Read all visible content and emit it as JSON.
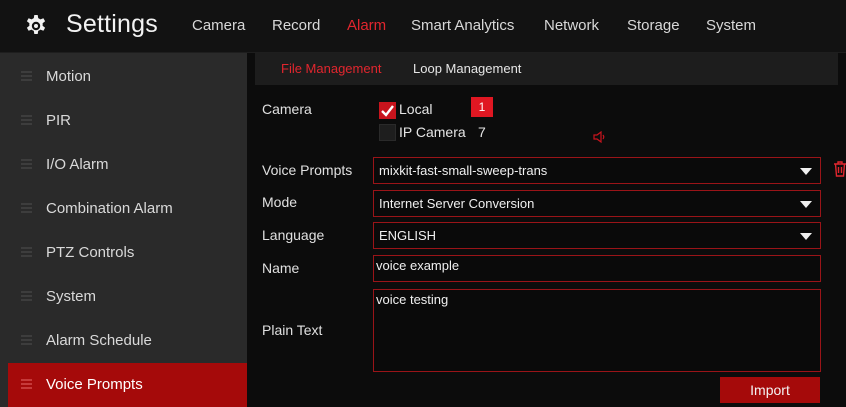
{
  "header": {
    "title": "Settings",
    "icon": "gear-icon",
    "tabs": [
      {
        "label": "Camera",
        "active": false
      },
      {
        "label": "Record",
        "active": false
      },
      {
        "label": "Alarm",
        "active": true
      },
      {
        "label": "Smart Analytics",
        "active": false
      },
      {
        "label": "Network",
        "active": false
      },
      {
        "label": "Storage",
        "active": false
      },
      {
        "label": "System",
        "active": false
      }
    ]
  },
  "sidebar": {
    "items": [
      {
        "label": "Motion",
        "active": false
      },
      {
        "label": "PIR",
        "active": false
      },
      {
        "label": "I/O Alarm",
        "active": false
      },
      {
        "label": "Combination Alarm",
        "active": false
      },
      {
        "label": "PTZ Controls",
        "active": false
      },
      {
        "label": "System",
        "active": false
      },
      {
        "label": "Alarm Schedule",
        "active": false
      },
      {
        "label": "Voice Prompts",
        "active": true
      }
    ]
  },
  "subtabs": [
    {
      "label": "File Management",
      "active": true
    },
    {
      "label": "Loop Management",
      "active": false
    }
  ],
  "form": {
    "camera": {
      "label": "Camera",
      "local": {
        "label": "Local",
        "checked": true,
        "badge": "1"
      },
      "ip_camera": {
        "label": "IP Camera",
        "checked": false,
        "count": "7"
      },
      "speaker_icon": "speaker-icon"
    },
    "voice_prompts": {
      "label": "Voice Prompts",
      "value": "mixkit-fast-small-sweep-trans",
      "delete_icon": "trash-icon"
    },
    "mode": {
      "label": "Mode",
      "value": "Internet Server Conversion"
    },
    "language": {
      "label": "Language",
      "value": "ENGLISH"
    },
    "name": {
      "label": "Name",
      "value": "voice example"
    },
    "plain_text": {
      "label": "Plain Text",
      "value": "voice testing"
    },
    "import_label": "Import"
  },
  "colors": {
    "accent": "#e1262e",
    "active_bg": "#a50a0a",
    "sidebar_bg": "#2a2a2a",
    "field_border": "#9a1418"
  }
}
